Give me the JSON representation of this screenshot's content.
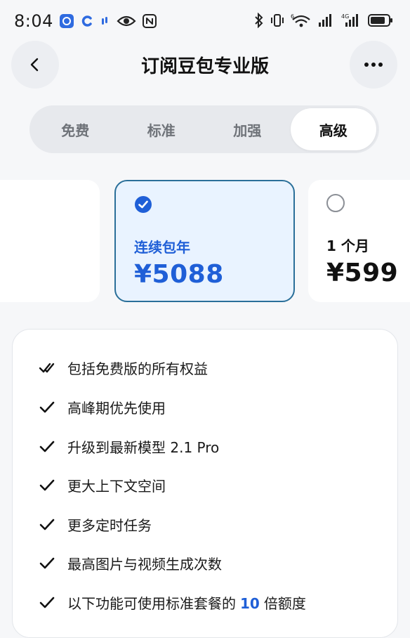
{
  "status_bar": {
    "time": "8:04",
    "left_icons": [
      "app-badge-icon",
      "c-app-icon",
      "notification-dot-icon",
      "eye-icon",
      "nfc-icon"
    ],
    "right_icons": [
      "bluetooth-icon",
      "vibrate-icon",
      "wifi-6-icon",
      "signal-icon",
      "signal-4g-icon",
      "battery-icon"
    ],
    "wifi_label": "6",
    "network_label": "4G"
  },
  "header": {
    "title": "订阅豆包专业版",
    "back_icon": "chevron-left-icon",
    "more_icon": "more-horizontal-icon"
  },
  "tabs": [
    {
      "label": "免费",
      "active": false
    },
    {
      "label": "标准",
      "active": false
    },
    {
      "label": "加强",
      "active": false
    },
    {
      "label": "高级",
      "active": true
    }
  ],
  "plans": [
    {
      "name": "",
      "price": "",
      "selected": false
    },
    {
      "name": "连续包年",
      "price": "¥5088",
      "selected": true
    },
    {
      "name": "1 个月",
      "price": "¥599",
      "selected": false
    }
  ],
  "features": {
    "items": [
      {
        "text": "包括免费版的所有权益"
      },
      {
        "text": "高峰期优先使用"
      },
      {
        "text": "升级到最新模型 2.1 Pro"
      },
      {
        "text": "更大上下文空间"
      },
      {
        "text": "更多定时任务"
      },
      {
        "text": "最高图片与视频生成次数"
      },
      {
        "text_before": "以下功能可使用标准套餐的",
        "highlight": "10",
        "text_after": "倍额度"
      }
    ]
  },
  "colors": {
    "accent": "#1f5fd7",
    "selected_border": "#2a6f99",
    "selected_bg": "#e9f3ff",
    "background": "#f6f7f9"
  }
}
